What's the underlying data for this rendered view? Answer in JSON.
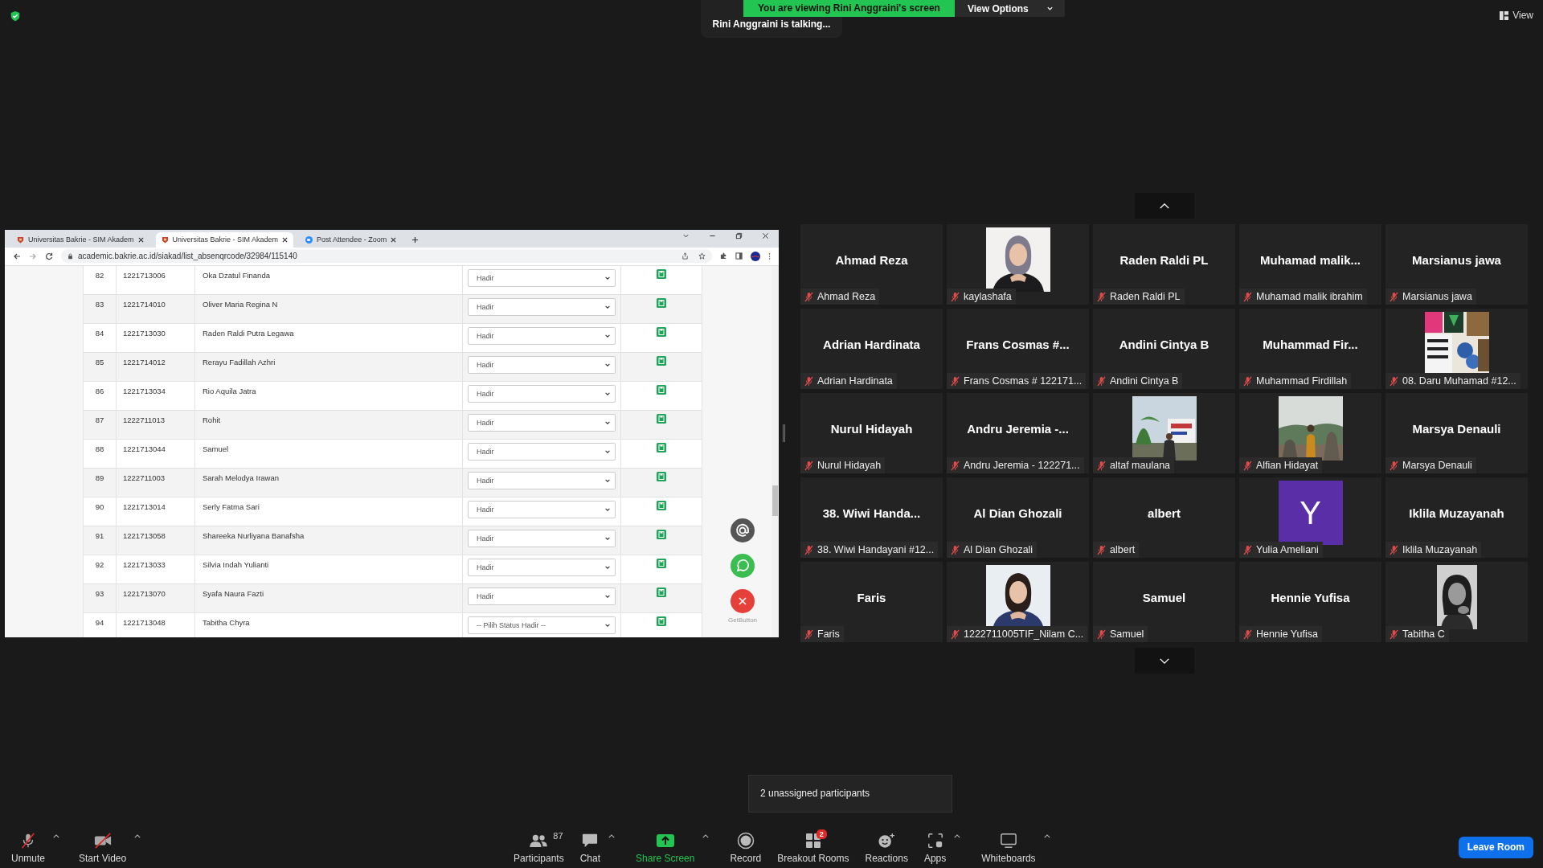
{
  "top_bar": {
    "talking": "Rini Anggraini is talking...",
    "banner": "You are viewing Rini Anggraini's screen",
    "view_options": "View Options",
    "view": "View"
  },
  "shared_screen": {
    "tabs": [
      {
        "title": "Universitas Bakrie - SIM Akadem",
        "selected": false
      },
      {
        "title": "Universitas Bakrie - SIM Akadem",
        "selected": true
      },
      {
        "title": "Post Attendee - Zoom",
        "selected": false
      }
    ],
    "url": "academic.bakrie.ac.id/siakad/list_absenqrcode/32984/115140",
    "rows": [
      {
        "no": "82",
        "nim": "1221713006",
        "name": "Oka Dzatul Finanda",
        "status": "Hadir"
      },
      {
        "no": "83",
        "nim": "1221714010",
        "name": "Oliver Maria Regina N",
        "status": "Hadir"
      },
      {
        "no": "84",
        "nim": "1221713030",
        "name": "Raden Raldi Putra Legawa",
        "status": "Hadir"
      },
      {
        "no": "85",
        "nim": "1221714012",
        "name": "Rerayu Fadillah Azhri",
        "status": "Hadir"
      },
      {
        "no": "86",
        "nim": "1221713034",
        "name": "Rio Aquila Jatra",
        "status": "Hadir"
      },
      {
        "no": "87",
        "nim": "1222711013",
        "name": "Rohit",
        "status": "Hadir"
      },
      {
        "no": "88",
        "nim": "1221713044",
        "name": "Samuel",
        "status": "Hadir"
      },
      {
        "no": "89",
        "nim": "1222711003",
        "name": "Sarah Melodya Irawan",
        "status": "Hadir"
      },
      {
        "no": "90",
        "nim": "1221713014",
        "name": "Serly Fatma Sari",
        "status": "Hadir"
      },
      {
        "no": "91",
        "nim": "1221713058",
        "name": "Shareeka Nurliyana Banafsha",
        "status": "Hadir"
      },
      {
        "no": "92",
        "nim": "1221713033",
        "name": "Silvia Indah Yulianti",
        "status": "Hadir"
      },
      {
        "no": "93",
        "nim": "1221713070",
        "name": "Syafa Naura Fazti",
        "status": "Hadir"
      },
      {
        "no": "94",
        "nim": "1221713048",
        "name": "Tabitha Chyra",
        "status": "-- Pilih Status Hadir --"
      }
    ],
    "widget_credit": "GetButton"
  },
  "participants": [
    {
      "kind": "name",
      "display": "Ahmad Reza",
      "label": "Ahmad Reza",
      "muted": true
    },
    {
      "kind": "picture",
      "label": "kaylashafa",
      "muted": true
    },
    {
      "kind": "name",
      "display": "Raden Raldi PL",
      "label": "Raden Raldi PL",
      "muted": true
    },
    {
      "kind": "name",
      "display": "Muhamad malik...",
      "label": "Muhamad malik ibrahim",
      "muted": true
    },
    {
      "kind": "name",
      "display": "Marsianus jawa",
      "label": "Marsianus jawa",
      "muted": true
    },
    {
      "kind": "name",
      "display": "Adrian Hardinata",
      "label": "Adrian Hardinata",
      "muted": true
    },
    {
      "kind": "name",
      "display": "Frans Cosmas #...",
      "label": "Frans Cosmas # 122171...",
      "muted": true
    },
    {
      "kind": "name",
      "display": "Andini Cintya B",
      "label": "Andini Cintya B",
      "muted": true
    },
    {
      "kind": "name",
      "display": "Muhammad Fir...",
      "label": "Muhammad Firdillah",
      "muted": true
    },
    {
      "kind": "picture",
      "label": "08. Daru Muhamad #12...",
      "muted": true
    },
    {
      "kind": "name",
      "display": "Nurul Hidayah",
      "label": "Nurul Hidayah",
      "muted": true
    },
    {
      "kind": "name",
      "display": "Andru Jeremia -...",
      "label": "Andru Jeremia - 122271...",
      "muted": true
    },
    {
      "kind": "picture",
      "label": "altaf maulana",
      "muted": true
    },
    {
      "kind": "picture",
      "label": "Alfian Hidayat",
      "muted": true
    },
    {
      "kind": "name",
      "display": "Marsya Denauli",
      "label": "Marsya Denauli",
      "muted": true
    },
    {
      "kind": "name",
      "display": "38. Wiwi Handa...",
      "label": "38. Wiwi Handayani #12...",
      "muted": true
    },
    {
      "kind": "name",
      "display": "Al Dian Ghozali",
      "label": "Al Dian Ghozali",
      "muted": true
    },
    {
      "kind": "name",
      "display": "albert",
      "label": "albert",
      "muted": true
    },
    {
      "kind": "avatar",
      "display": "Y",
      "label": "Yulia Ameliani",
      "muted": true
    },
    {
      "kind": "name",
      "display": "Iklila Muzayanah",
      "label": "Iklila Muzayanah",
      "muted": true
    },
    {
      "kind": "name",
      "display": "Faris",
      "label": "Faris",
      "muted": true
    },
    {
      "kind": "picture",
      "label": "1222711005TIF_Nilam C...",
      "muted": true
    },
    {
      "kind": "name",
      "display": "Samuel",
      "label": "Samuel",
      "muted": true
    },
    {
      "kind": "name",
      "display": "Hennie Yufisa",
      "label": "Hennie Yufisa",
      "muted": true
    },
    {
      "kind": "picture",
      "label": "Tabitha C",
      "muted": true
    }
  ],
  "tooltip": "2 unassigned participants",
  "toolbar": [
    {
      "kind": "mic",
      "label": "Unmute",
      "caret": true
    },
    {
      "kind": "video",
      "label": "Start Video",
      "caret": true
    },
    {
      "kind": "participants",
      "label": "Participants",
      "count": "87",
      "caret": false
    },
    {
      "kind": "chat",
      "label": "Chat",
      "caret": true
    },
    {
      "kind": "share",
      "label": "Share Screen",
      "caret": true
    },
    {
      "kind": "record",
      "label": "Record",
      "caret": false
    },
    {
      "kind": "breakout",
      "label": "Breakout Rooms",
      "badge": "2",
      "caret": false
    },
    {
      "kind": "reactions",
      "label": "Reactions",
      "caret": false
    },
    {
      "kind": "apps",
      "label": "Apps",
      "caret": true
    },
    {
      "kind": "whiteboards",
      "label": "Whiteboards",
      "caret": true
    }
  ],
  "leave_button": "Leave Room"
}
